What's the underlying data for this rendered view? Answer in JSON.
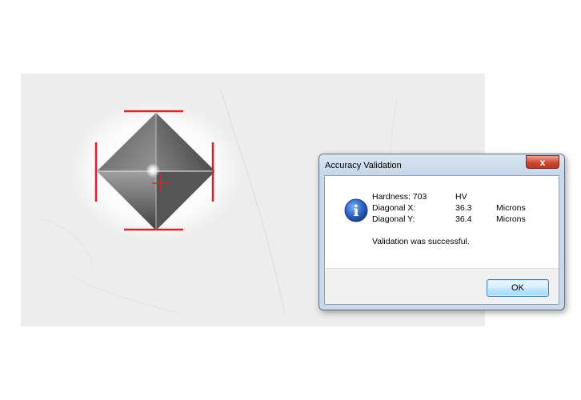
{
  "dialog": {
    "title": "Accuracy Validation",
    "close_glyph": "x",
    "icon": "info-icon",
    "icon_glyph": "i",
    "results": {
      "hardness_label": "Hardness: 703",
      "hardness_unit": "HV",
      "diag_x_label": "Diagonal X:",
      "diag_x_value": "36.3",
      "diag_x_unit": "Microns",
      "diag_y_label": "Diagonal Y:",
      "diag_y_value": "36.4",
      "diag_y_unit": "Microns"
    },
    "message": "Validation was successful.",
    "ok_label": "OK"
  },
  "colors": {
    "measure_lines": "#e0202a",
    "dialog_frame": "#c9d9ea",
    "icon_blue": "#2e66c4"
  }
}
